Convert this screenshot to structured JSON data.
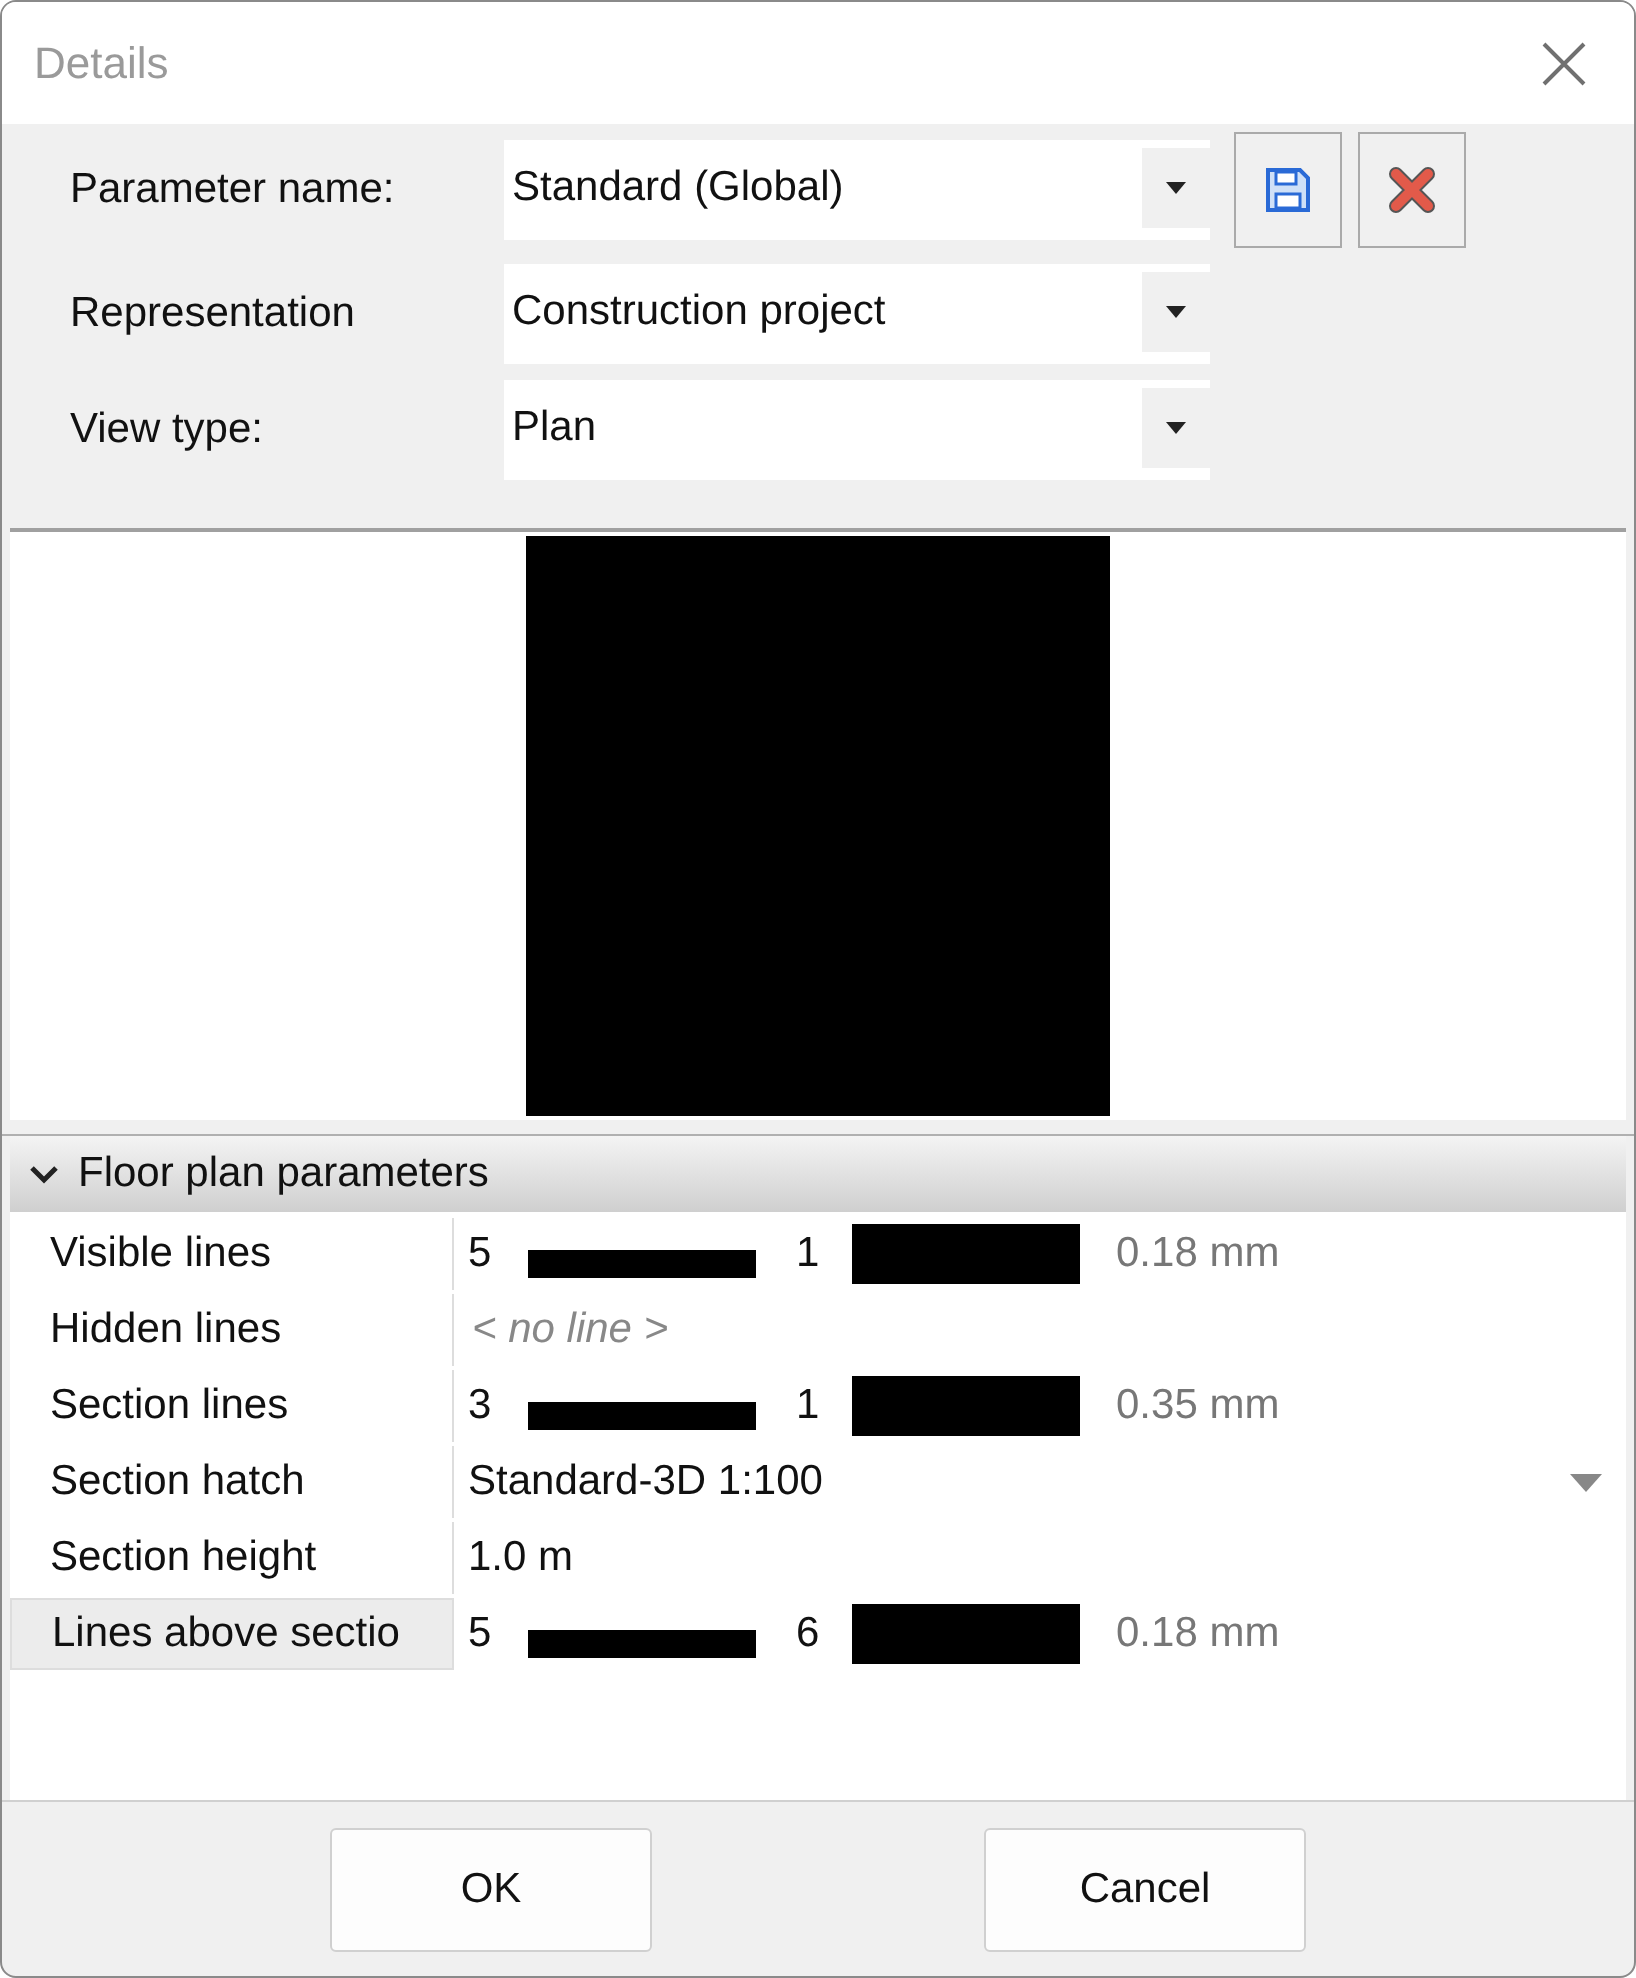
{
  "window": {
    "title": "Details"
  },
  "fields": [
    {
      "label": "Parameter name:",
      "value": "Standard (Global)"
    },
    {
      "label": "Representation",
      "value": "Construction project"
    },
    {
      "label": "View type:",
      "value": "Plan"
    }
  ],
  "section": {
    "title": "Floor plan parameters",
    "expanded": true
  },
  "rows": [
    {
      "kind": "line",
      "label": "Visible lines",
      "pen": "5",
      "line": "1",
      "width": "0.18 mm",
      "selected": false
    },
    {
      "kind": "none",
      "label": "Hidden lines",
      "value": "< no line >",
      "selected": false
    },
    {
      "kind": "line",
      "label": "Section lines",
      "pen": "3",
      "line": "1",
      "width": "0.35 mm",
      "selected": false
    },
    {
      "kind": "dropdown",
      "label": "Section hatch",
      "value": "Standard-3D 1:100",
      "selected": false
    },
    {
      "kind": "text",
      "label": "Section height",
      "value": "1.0 m",
      "selected": false
    },
    {
      "kind": "line",
      "label": "Lines above sectio",
      "pen": "5",
      "line": "6",
      "width": "0.18 mm",
      "selected": true
    }
  ],
  "buttons": [
    "OK",
    "Cancel"
  ]
}
